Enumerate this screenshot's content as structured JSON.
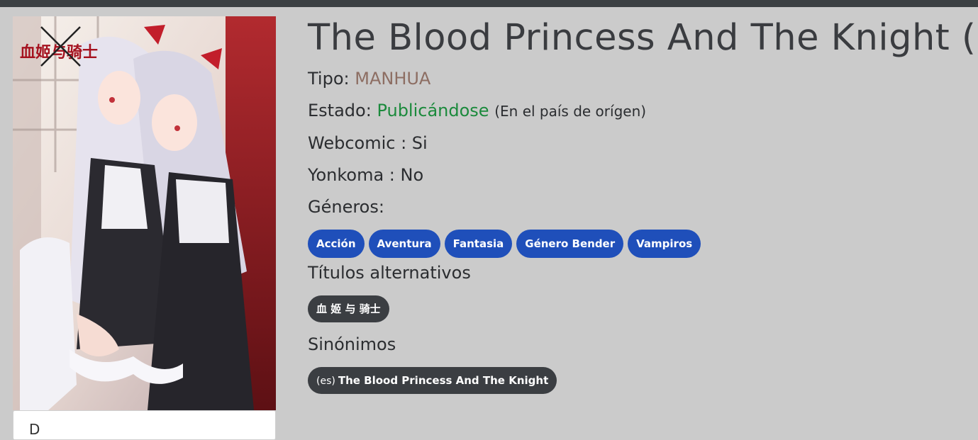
{
  "manga": {
    "title": "The Blood Princess And The Knight (",
    "tipo_label": "Tipo:",
    "tipo_value": "MANHUA",
    "estado_label": "Estado:",
    "estado_value": "Publicándose",
    "estado_note": "(En el país de orígen)",
    "webcomic": "Webcomic : Si",
    "yonkoma": "Yonkoma : No",
    "generos_label": "Géneros:",
    "genres": [
      "Acción",
      "Aventura",
      "Fantasia",
      "Género Bender",
      "Vampiros"
    ],
    "alt_titles_label": "Títulos alternativos",
    "alt_titles": [
      "血 姬 与 骑士"
    ],
    "synonyms_label": "Sinónimos",
    "synonyms": [
      {
        "lang": "(es)",
        "text": "The Blood Princess And The Knight"
      }
    ]
  },
  "cover": {
    "logo_text": "血姬与骑士",
    "card_text": "D"
  },
  "colors": {
    "background": "#cbcbcb",
    "genre_chip": "#1f4fba",
    "dark_chip": "#3b3e42",
    "tipo": "#8d6e63",
    "estado": "#1b8a3c"
  }
}
